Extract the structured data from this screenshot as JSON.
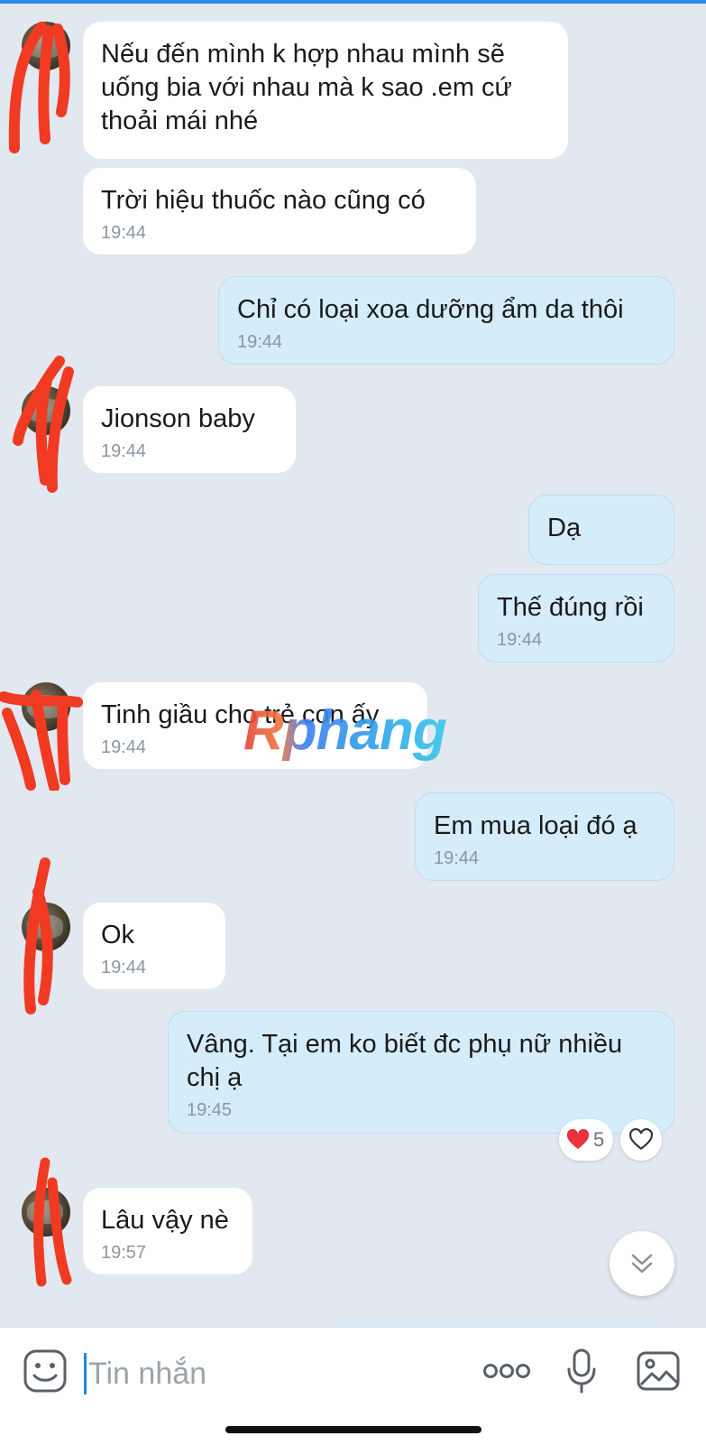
{
  "colors": {
    "accent": "#2b8cf0",
    "incoming_bubble": "#ffffff",
    "outgoing_bubble": "#d5ecfb",
    "background": "#e2e8ef",
    "heart": "#e8323c"
  },
  "watermark": "Rphang",
  "messages": [
    {
      "side": "in",
      "text": "Nếu đến mình k hợp nhau mình sẽ\nuống bia với nhau mà k sao .em cứ\nthoải mái nhé",
      "time": ""
    },
    {
      "side": "in",
      "text": "Trời hiệu thuốc nào cũng có",
      "time": "19:44"
    },
    {
      "side": "out",
      "text": "Chỉ có loại xoa dưỡng ẩm da thôi",
      "time": "19:44"
    },
    {
      "side": "in",
      "text": "Jionson baby",
      "time": "19:44"
    },
    {
      "side": "out",
      "text": "Dạ",
      "time": ""
    },
    {
      "side": "out",
      "text": "Thế đúng rồi",
      "time": "19:44"
    },
    {
      "side": "in",
      "text": "Tinh giầu cho trẻ con ấy",
      "time": "19:44"
    },
    {
      "side": "out",
      "text": "Em mua loại đó ạ",
      "time": "19:44"
    },
    {
      "side": "in",
      "text": "Ok",
      "time": "19:44"
    },
    {
      "side": "out",
      "text": "Vâng. Tại em ko biết đc phụ nữ nhiều\nchị ạ",
      "time": "19:45"
    },
    {
      "side": "in",
      "text": "Lâu vậy nè",
      "time": "19:57"
    }
  ],
  "reaction": {
    "icon": "heart-icon",
    "count": "5",
    "add_icon": "heart-outline-icon"
  },
  "input": {
    "placeholder": "Tin nhắn"
  },
  "icons": [
    "sticker-icon",
    "more-icon",
    "microphone-icon",
    "image-icon",
    "chevron-double-down-icon"
  ]
}
